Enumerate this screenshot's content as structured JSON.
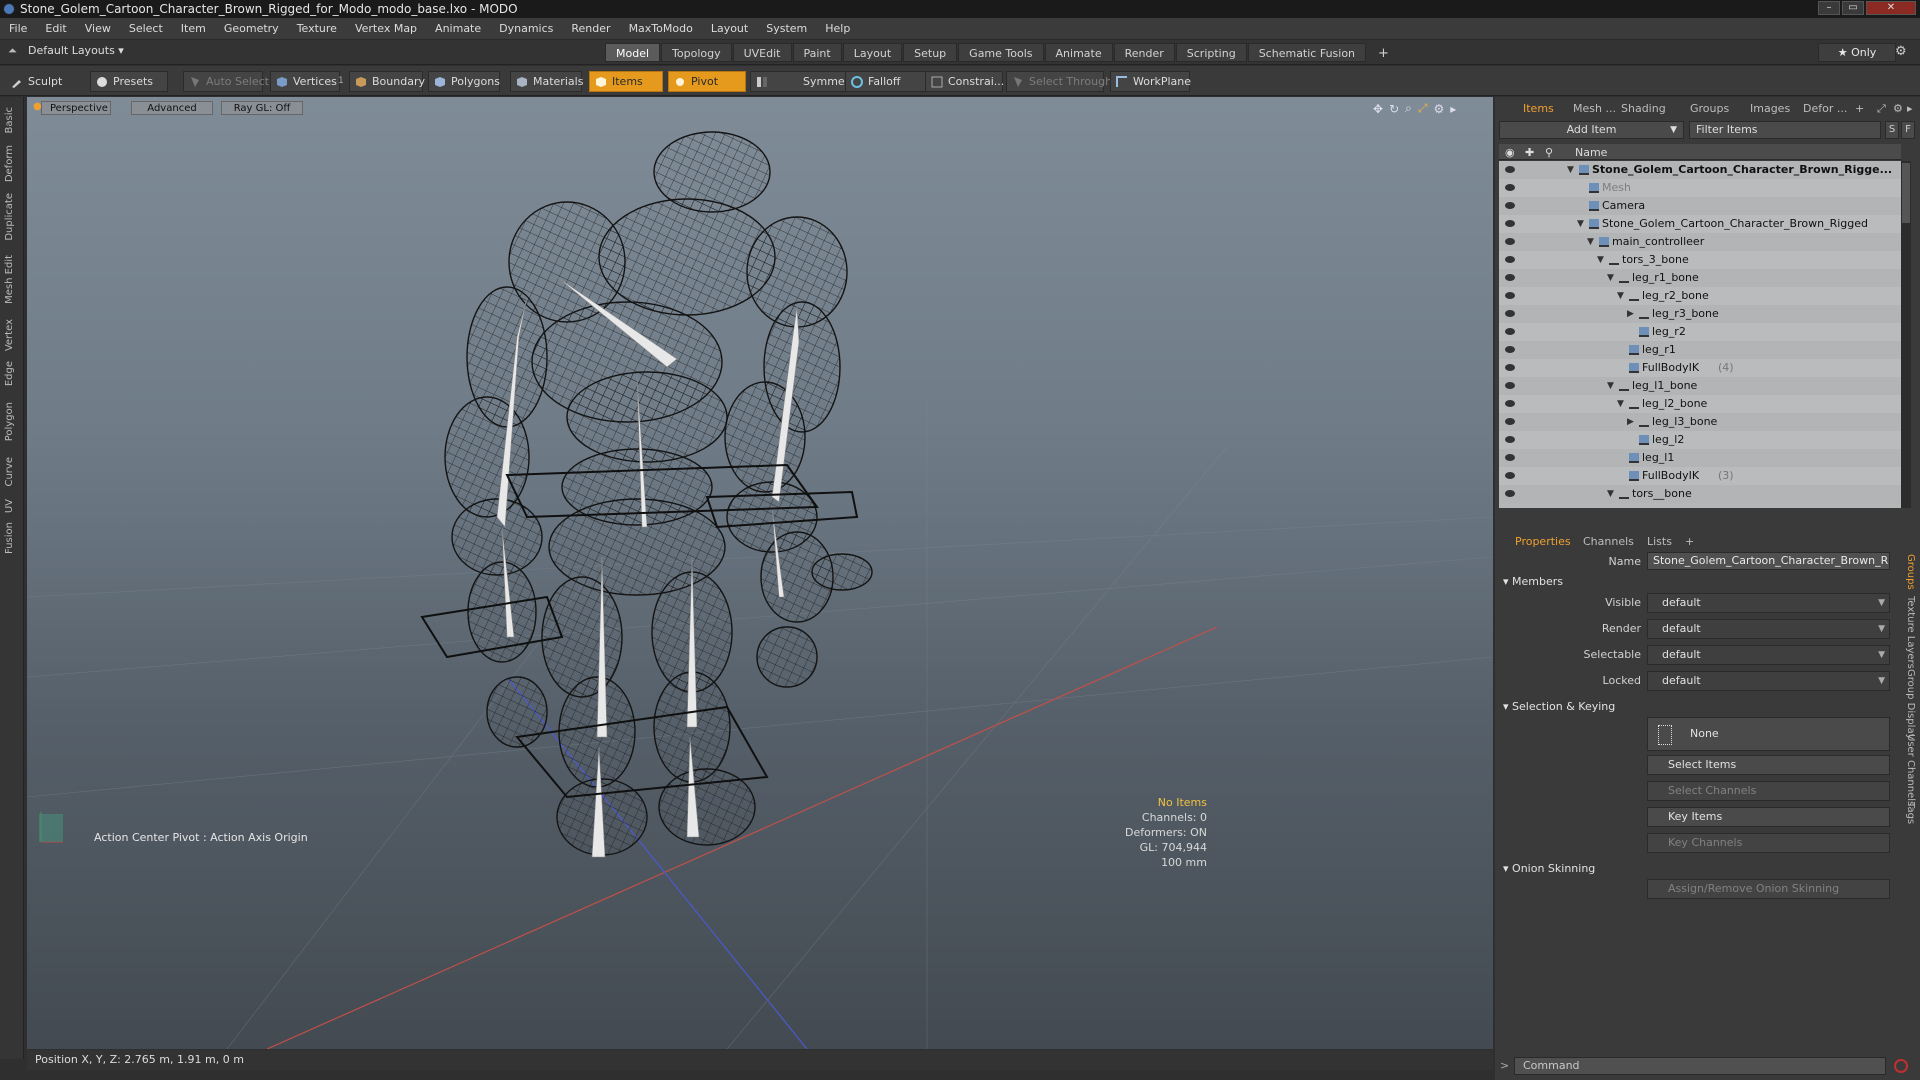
{
  "window": {
    "title": "Stone_Golem_Cartoon_Character_Brown_Rigged_for_Modo_modo_base.lxo - MODO"
  },
  "menu": [
    "File",
    "Edit",
    "View",
    "Select",
    "Item",
    "Geometry",
    "Texture",
    "Vertex Map",
    "Animate",
    "Dynamics",
    "Render",
    "MaxToModo",
    "Layout",
    "System",
    "Help"
  ],
  "layout": {
    "selector": "Default Layouts ▾",
    "tabs": [
      "Model",
      "Topology",
      "UVEdit",
      "Paint",
      "Layout",
      "Setup",
      "Game Tools",
      "Animate",
      "Render",
      "Scripting",
      "Schematic Fusion"
    ],
    "active_tab": "Model",
    "only_label": "★  Only"
  },
  "toolbar": {
    "sculpt": "Sculpt",
    "presets": "Presets",
    "auto_select": "Auto Select",
    "vertices": "Vertices",
    "vertices_count": "1",
    "boundary": "Boundary",
    "polygons": "Polygons",
    "materials": "Materials",
    "items": "Items",
    "pivot": "Pivot",
    "symmetry": "Symmetry",
    "falloff": "Falloff",
    "constraints": "Constrai...",
    "select_through": "Select Through",
    "workplane": "WorkPlane"
  },
  "left_tabs": [
    "Basic",
    "Deform",
    "Duplicate",
    "Mesh Edit",
    "Vertex",
    "Edge",
    "Polygon",
    "Curve",
    "UV",
    "Fusion"
  ],
  "viewport": {
    "view_mode": "Perspective",
    "advanced": "Advanced",
    "raygl": "Ray GL: Off",
    "action_center": "Action Center Pivot : Action Axis Origin",
    "hud": {
      "line1": "No Items",
      "line2": "Channels: 0",
      "line3": "Deformers: ON",
      "line4": "GL: 704,944",
      "line5": "100 mm"
    }
  },
  "status": {
    "position": "Position X, Y, Z:  2.765 m, 1.91 m, 0 m"
  },
  "panel": {
    "tabs": [
      "Items",
      "Mesh ...",
      "Shading",
      "Groups",
      "Images",
      "Defor ..."
    ],
    "add_item": "Add Item",
    "filter_placeholder": "Filter Items",
    "name_header": "Name",
    "tree": [
      {
        "label": "Stone_Golem_Cartoon_Character_Brown_Rigge...",
        "indent": 0,
        "style": "bold",
        "expander": "▼"
      },
      {
        "label": "Mesh",
        "indent": 1,
        "style": "dim",
        "expander": ""
      },
      {
        "label": "Camera",
        "indent": 1,
        "style": "",
        "expander": ""
      },
      {
        "label": "Stone_Golem_Cartoon_Character_Brown_Rigged",
        "indent": 1,
        "style": "",
        "expander": "▼"
      },
      {
        "label": "main_controlleer",
        "indent": 2,
        "style": "",
        "expander": "▼"
      },
      {
        "label": "tors_3_bone",
        "indent": 3,
        "style": "",
        "expander": "▼"
      },
      {
        "label": "leg_r1_bone",
        "indent": 4,
        "style": "",
        "expander": "▼"
      },
      {
        "label": "leg_r2_bone",
        "indent": 5,
        "style": "",
        "expander": "▼"
      },
      {
        "label": "leg_r3_bone",
        "indent": 6,
        "style": "",
        "expander": "▶"
      },
      {
        "label": "leg_r2",
        "indent": 6,
        "style": "",
        "expander": ""
      },
      {
        "label": "leg_r1",
        "indent": 5,
        "style": "",
        "expander": ""
      },
      {
        "label": "FullBodyIK",
        "count": "(4)",
        "indent": 5,
        "style": "",
        "expander": ""
      },
      {
        "label": "leg_l1_bone",
        "indent": 4,
        "style": "",
        "expander": "▼"
      },
      {
        "label": "leg_l2_bone",
        "indent": 5,
        "style": "",
        "expander": "▼"
      },
      {
        "label": "leg_l3_bone",
        "indent": 6,
        "style": "",
        "expander": "▶"
      },
      {
        "label": "leg_l2",
        "indent": 6,
        "style": "",
        "expander": ""
      },
      {
        "label": "leg_l1",
        "indent": 5,
        "style": "",
        "expander": ""
      },
      {
        "label": "FullBodyIK",
        "count": "(3)",
        "indent": 5,
        "style": "",
        "expander": ""
      },
      {
        "label": "tors__bone",
        "indent": 4,
        "style": "",
        "expander": "▼"
      }
    ],
    "prop_tabs": [
      "Properties",
      "Channels",
      "Lists"
    ],
    "name_label": "Name",
    "name_value": "Stone_Golem_Cartoon_Character_Brown_Rigged",
    "members": "Members",
    "visible_label": "Visible",
    "visible_value": "default",
    "render_label": "Render",
    "render_value": "default",
    "selectable_label": "Selectable",
    "selectable_value": "default",
    "locked_label": "Locked",
    "locked_value": "default",
    "sel_keying": "Selection & Keying",
    "none": "None",
    "select_items": "Select Items",
    "select_channels": "Select Channels",
    "key_items": "Key Items",
    "key_channels": "Key Channels",
    "onion": "Onion Skinning",
    "assign_onion": "Assign/Remove Onion Skinning",
    "right_tabs": [
      "Groups",
      "Texture Layers",
      "Group Display",
      "User Channels",
      "Tags"
    ],
    "command_placeholder": "Command"
  },
  "colors": {
    "accent": "#e59a1e",
    "wire": "#1a1a1a",
    "bone": "#e8e8e8"
  }
}
